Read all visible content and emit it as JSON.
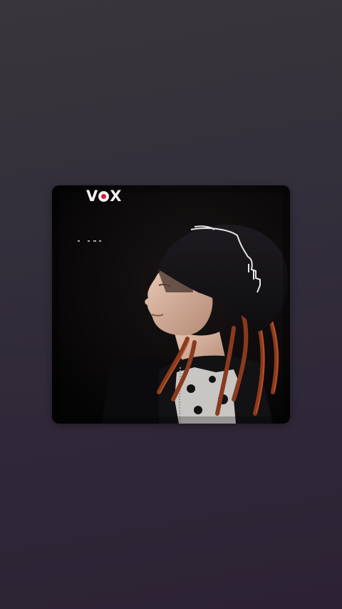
{
  "logo": {
    "letter_left": "V",
    "letter_right": "X",
    "accent_color": "#d2203a"
  },
  "background": {
    "top_color": "#38363a",
    "bottom_color": "#2c2233"
  },
  "photo": {
    "icon": "photo-of-person-in-beanie-with-dreadlocks"
  }
}
